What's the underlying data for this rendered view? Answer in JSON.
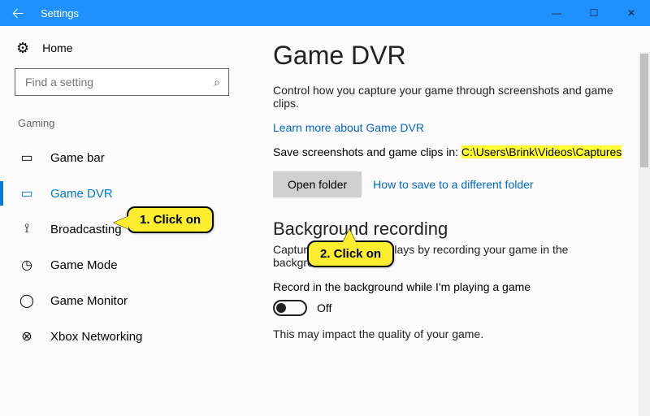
{
  "titlebar": {
    "title": "Settings"
  },
  "sidebar": {
    "home": "Home",
    "search_placeholder": "Find a setting",
    "category": "Gaming",
    "items": [
      {
        "icon": "game-bar",
        "label": "Game bar"
      },
      {
        "icon": "game-dvr",
        "label": "Game DVR"
      },
      {
        "icon": "broadcasting",
        "label": "Broadcasting"
      },
      {
        "icon": "game-mode",
        "label": "Game Mode"
      },
      {
        "icon": "game-monitor",
        "label": "Game Monitor"
      },
      {
        "icon": "xbox-net",
        "label": "Xbox Networking"
      }
    ]
  },
  "content": {
    "heading": "Game DVR",
    "lead": "Control how you capture your game through screenshots and game clips.",
    "learn_link": "Learn more about Game DVR",
    "save_prefix": "Save screenshots and game clips in: ",
    "save_path": "C:\\Users\\Brink\\Videos\\Captures",
    "open_folder": "Open folder",
    "howto_link": "How to save to a different folder",
    "bg_heading": "Background recording",
    "bg_desc": "Capture your previous plays by recording your game in the background.",
    "record_toggle_label": "Record in the background while I'm playing a game",
    "toggle_state": "Off",
    "impact_note": "This may impact the quality of your game."
  },
  "annotations": {
    "c1": "1. Click on",
    "c2": "2. Click on"
  }
}
